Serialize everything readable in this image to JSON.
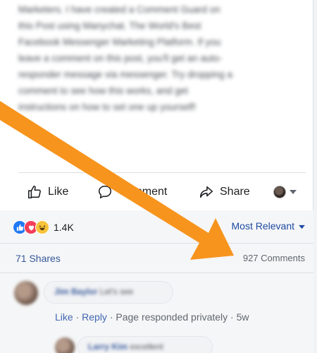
{
  "post": {
    "text_lines": [
      "Marketers. I have created a Comment Guard on",
      "this Post using Manychat. The World's Best",
      "Facebook Messenger Marketing Platform. If you",
      "leave a comment on this post, you'll get an auto-",
      "responder message via messenger. Try dropping a",
      "comment to see how this works, and get",
      "instructions on how to set one up yourself!"
    ]
  },
  "actions": {
    "like_label": "Like",
    "comment_label": "Comment",
    "share_label": "Share"
  },
  "feedback": {
    "reaction_count": "1.4K",
    "sort_label": "Most Relevant",
    "shares_label": "71 Shares",
    "comments_label": "927 Comments"
  },
  "comment": {
    "author": "Jim Baylor",
    "text": "Let's see",
    "like_label": "Like",
    "sep1": " · ",
    "reply_label": "Reply",
    "sep2": " · ",
    "responded_label": "Page responded privately",
    "sep3": " · ",
    "time": "5w"
  },
  "reply": {
    "author": "Larry Kim",
    "text": "excellent"
  },
  "colors": {
    "arrow": "#f7941d",
    "link": "#365899",
    "like_reaction": "#2078f4",
    "love_reaction": "#f33e58",
    "haha_reaction": "#f7c33b"
  },
  "icons": [
    "thumbs-up-icon",
    "comment-bubble-icon",
    "share-arrow-icon",
    "caret-down-icon",
    "like-reaction-icon",
    "love-reaction-icon",
    "haha-reaction-icon"
  ]
}
